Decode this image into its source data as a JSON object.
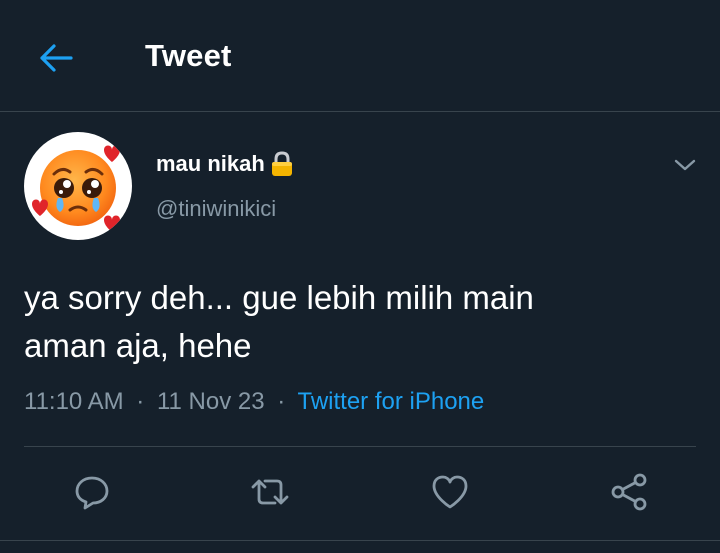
{
  "header": {
    "title": "Tweet"
  },
  "tweet": {
    "author_name": "mau nikah",
    "author_handle": "@tiniwinikici",
    "text_line1": "ya sorry deh... gue lebih milih main",
    "text_line2": "aman aja, hehe",
    "time": "11:10 AM",
    "date": "11 Nov 23",
    "separator": "·",
    "source": "Twitter for iPhone"
  },
  "icons": {
    "back": "arrow-left-icon",
    "lock": "lock-icon",
    "more": "chevron-down-icon",
    "reply": "reply-icon",
    "retweet": "retweet-icon",
    "like": "heart-icon",
    "share": "share-icon",
    "avatar": "pleading-face-with-hearts-emoji"
  },
  "colors": {
    "background": "#15202b",
    "accent": "#1da1f2",
    "secondary_text": "#8899a6",
    "border": "#38444d"
  }
}
